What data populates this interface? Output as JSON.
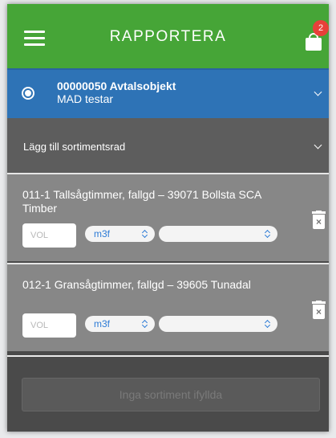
{
  "header": {
    "title": "RAPPORTERA",
    "menu_icon": "hamburger-menu-icon",
    "cart_icon": "shopping-bag-icon",
    "badge_count": "2",
    "bg_color": "#46a537"
  },
  "contract_object": {
    "title": "00000050 Avtalsobjekt",
    "subtitle": "MAD testar",
    "selected": true,
    "bg_color": "#2e73b6"
  },
  "add_row": {
    "label": "Lägg till sortimentsrad"
  },
  "items": [
    {
      "name": "011-1 Tallsågtimmer, fallgd – 39071 Bollsta SCA Timber",
      "vol_placeholder": "VOL",
      "unit": "m3f",
      "grade": ""
    },
    {
      "name": "012-1 Gransågtimmer, fallgd – 39605 Tunadal",
      "vol_placeholder": "VOL",
      "unit": "m3f",
      "grade": ""
    }
  ],
  "footer": {
    "submit_label": "Inga sortiment ifyllda"
  }
}
